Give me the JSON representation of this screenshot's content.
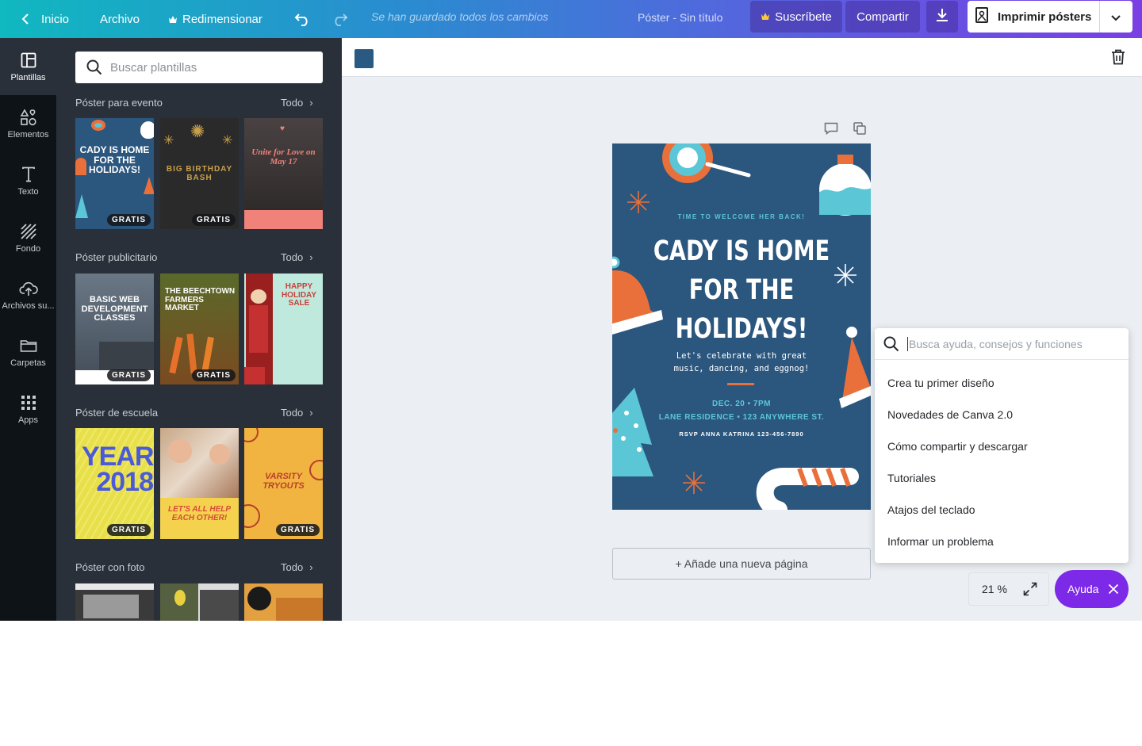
{
  "topbar": {
    "home": "Inicio",
    "file": "Archivo",
    "resize": "Redimensionar",
    "saved_status": "Se han guardado todos los cambios",
    "doc_title": "Póster - Sin título",
    "subscribe": "Suscríbete",
    "share": "Compartir",
    "print": "Imprimir pósters"
  },
  "rail": {
    "items": [
      {
        "label": "Plantillas",
        "icon": "layout-icon"
      },
      {
        "label": "Elementos",
        "icon": "shapes-icon"
      },
      {
        "label": "Texto",
        "icon": "text-icon"
      },
      {
        "label": "Fondo",
        "icon": "background-icon"
      },
      {
        "label": "Archivos su...",
        "icon": "upload-icon"
      },
      {
        "label": "Carpetas",
        "icon": "folder-icon"
      },
      {
        "label": "Apps",
        "icon": "apps-icon"
      }
    ]
  },
  "panel": {
    "search_placeholder": "Buscar plantillas",
    "see_all": "Todo",
    "free_badge": "GRATIS",
    "sections": [
      {
        "title": "Póster para evento",
        "thumbs": [
          {
            "text": "CADY IS HOME FOR THE HOLIDAYS!",
            "bg": "#2b567e",
            "color": "#ffffff",
            "free": true
          },
          {
            "text": "BIG BIRTHDAY BASH",
            "bg": "#2a2a2a",
            "color": "#c9a04a",
            "free": true
          },
          {
            "text": "Unite for Love on May 17",
            "bg": "#3b3535",
            "color": "#f0827a",
            "free": false
          }
        ]
      },
      {
        "title": "Póster publicitario",
        "thumbs": [
          {
            "text": "BASIC WEB DEVELOPMENT CLASSES",
            "bg": "#5c6a78",
            "color": "#ffffff",
            "free": true
          },
          {
            "text": "THE BEECHTOWN FARMERS MARKET",
            "bg": "#6a5a2a",
            "color": "#ffffff",
            "free": true
          },
          {
            "text": "HAPPY HOLIDAY SALE",
            "bg": "#bfe9dc",
            "color": "#c8403a",
            "free": false
          }
        ]
      },
      {
        "title": "Póster de escuela",
        "thumbs": [
          {
            "text": "YEAR 2018",
            "bg": "#e8e04a",
            "color": "#4a5ad8",
            "free": true
          },
          {
            "text": "LET'S ALL HELP EACH OTHER!",
            "bg": "#f4d24e",
            "color": "#d84a3a",
            "free": false
          },
          {
            "text": "VARSITY TRYOUTS",
            "bg": "#f2b440",
            "color": "#b8402a",
            "free": true
          }
        ]
      },
      {
        "title": "Póster con foto",
        "thumbs": [
          {
            "text": "",
            "bg": "#d9d9d9",
            "color": "#333",
            "free": false
          },
          {
            "text": "",
            "bg": "#8a8f70",
            "color": "#333",
            "free": false
          },
          {
            "text": "",
            "bg": "#e3a040",
            "color": "#333",
            "free": false
          }
        ]
      }
    ]
  },
  "poster": {
    "subtitle": "TIME TO WELCOME HER BACK!",
    "title_lines": [
      "CADY IS HOME",
      "FOR THE",
      "HOLIDAYS!"
    ],
    "body_lines": [
      "Let's celebrate with great",
      "music, dancing, and eggnog!"
    ],
    "date": "DEC. 20 • 7PM",
    "location": "LANE RESIDENCE • 123 ANYWHERE ST.",
    "rsvp": "RSVP ANNA KATRINA 123-456-7890",
    "background": "#2b567e"
  },
  "editor": {
    "swatch_color": "#2a5a82",
    "add_page": "+ Añade una nueva página",
    "zoom": "21 %"
  },
  "help": {
    "placeholder": "Busca ayuda, consejos y funciones",
    "items": [
      "Crea tu primer diseño",
      "Novedades de Canva 2.0",
      "Cómo compartir y descargar",
      "Tutoriales",
      "Atajos del teclado",
      "Informar un problema"
    ],
    "button": "Ayuda"
  }
}
